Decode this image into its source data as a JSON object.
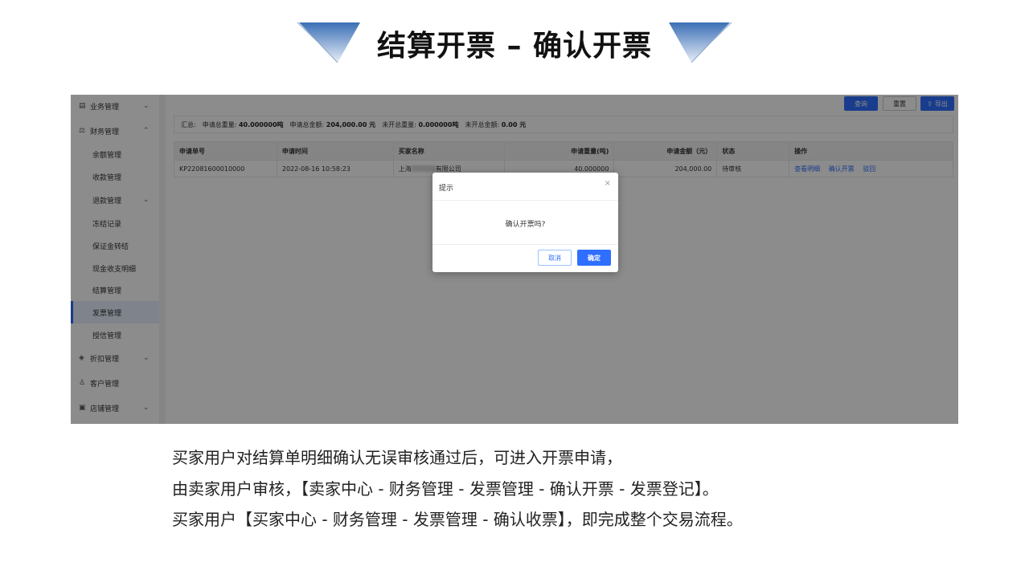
{
  "slide": {
    "title": "结算开票 – 确认开票",
    "description": [
      "买家用户对结算单明细确认无误审核通过后，可进入开票申请，",
      "由卖家用户审核，【卖家中心 - 财务管理 - 发票管理 - 确认开票 - 发票登记】。",
      "买家用户【买家中心 - 财务管理 - 发票管理 - 确认收票】，即完成整个交易流程。"
    ]
  },
  "sidebar": {
    "items": [
      {
        "label": "业务管理",
        "icon": "document-icon",
        "expand": "chevron-down-icon"
      },
      {
        "label": "财务管理",
        "icon": "finance-icon",
        "expand": "chevron-up-icon"
      },
      {
        "label": "余额管理"
      },
      {
        "label": "收款管理"
      },
      {
        "label": "退款管理",
        "expand": "chevron-down-icon"
      },
      {
        "label": "冻结记录"
      },
      {
        "label": "保证金转结"
      },
      {
        "label": "现金收支明细"
      },
      {
        "label": "结算管理"
      },
      {
        "label": "发票管理",
        "active": true
      },
      {
        "label": "授信管理"
      },
      {
        "label": "折扣管理",
        "icon": "tag-icon",
        "expand": "chevron-down-icon"
      },
      {
        "label": "客户管理",
        "icon": "user-icon"
      },
      {
        "label": "店铺管理",
        "icon": "store-icon",
        "expand": "chevron-down-icon"
      }
    ]
  },
  "toolbar": {
    "query": "查询",
    "reset": "重置",
    "export": "导出"
  },
  "summary": {
    "label": "汇总:",
    "apply_weight_label": "申请总重量:",
    "apply_weight_value": "40.000000吨",
    "apply_amount_label": "申请总金额:",
    "apply_amount_value": "204,000.00 元",
    "unopened_weight_label": "未开总重量:",
    "unopened_weight_value": "0.000000吨",
    "unopened_amount_label": "未开总金额:",
    "unopened_amount_value": "0.00 元"
  },
  "table": {
    "headers": [
      "申请单号",
      "申请时间",
      "买家名称",
      "申请重量(吨)",
      "申请金额（元）",
      "状态",
      "操作"
    ],
    "rows": [
      {
        "no": "KP22081600010000",
        "time": "2022-08-16 10:58:23",
        "buyer_prefix": "上海",
        "buyer_suffix": "有限公司",
        "weight": "40.000000",
        "amount": "204,000.00",
        "status": "待审核",
        "actions": [
          "查看明细",
          "确认开票",
          "驳回"
        ]
      }
    ]
  },
  "dialog": {
    "title": "提示",
    "close": "×",
    "message": "确认开票吗?",
    "cancel": "取消",
    "ok": "确定"
  },
  "colors": {
    "accent": "#2f6fff",
    "mask": "rgba(0,0,0,0.45)"
  }
}
